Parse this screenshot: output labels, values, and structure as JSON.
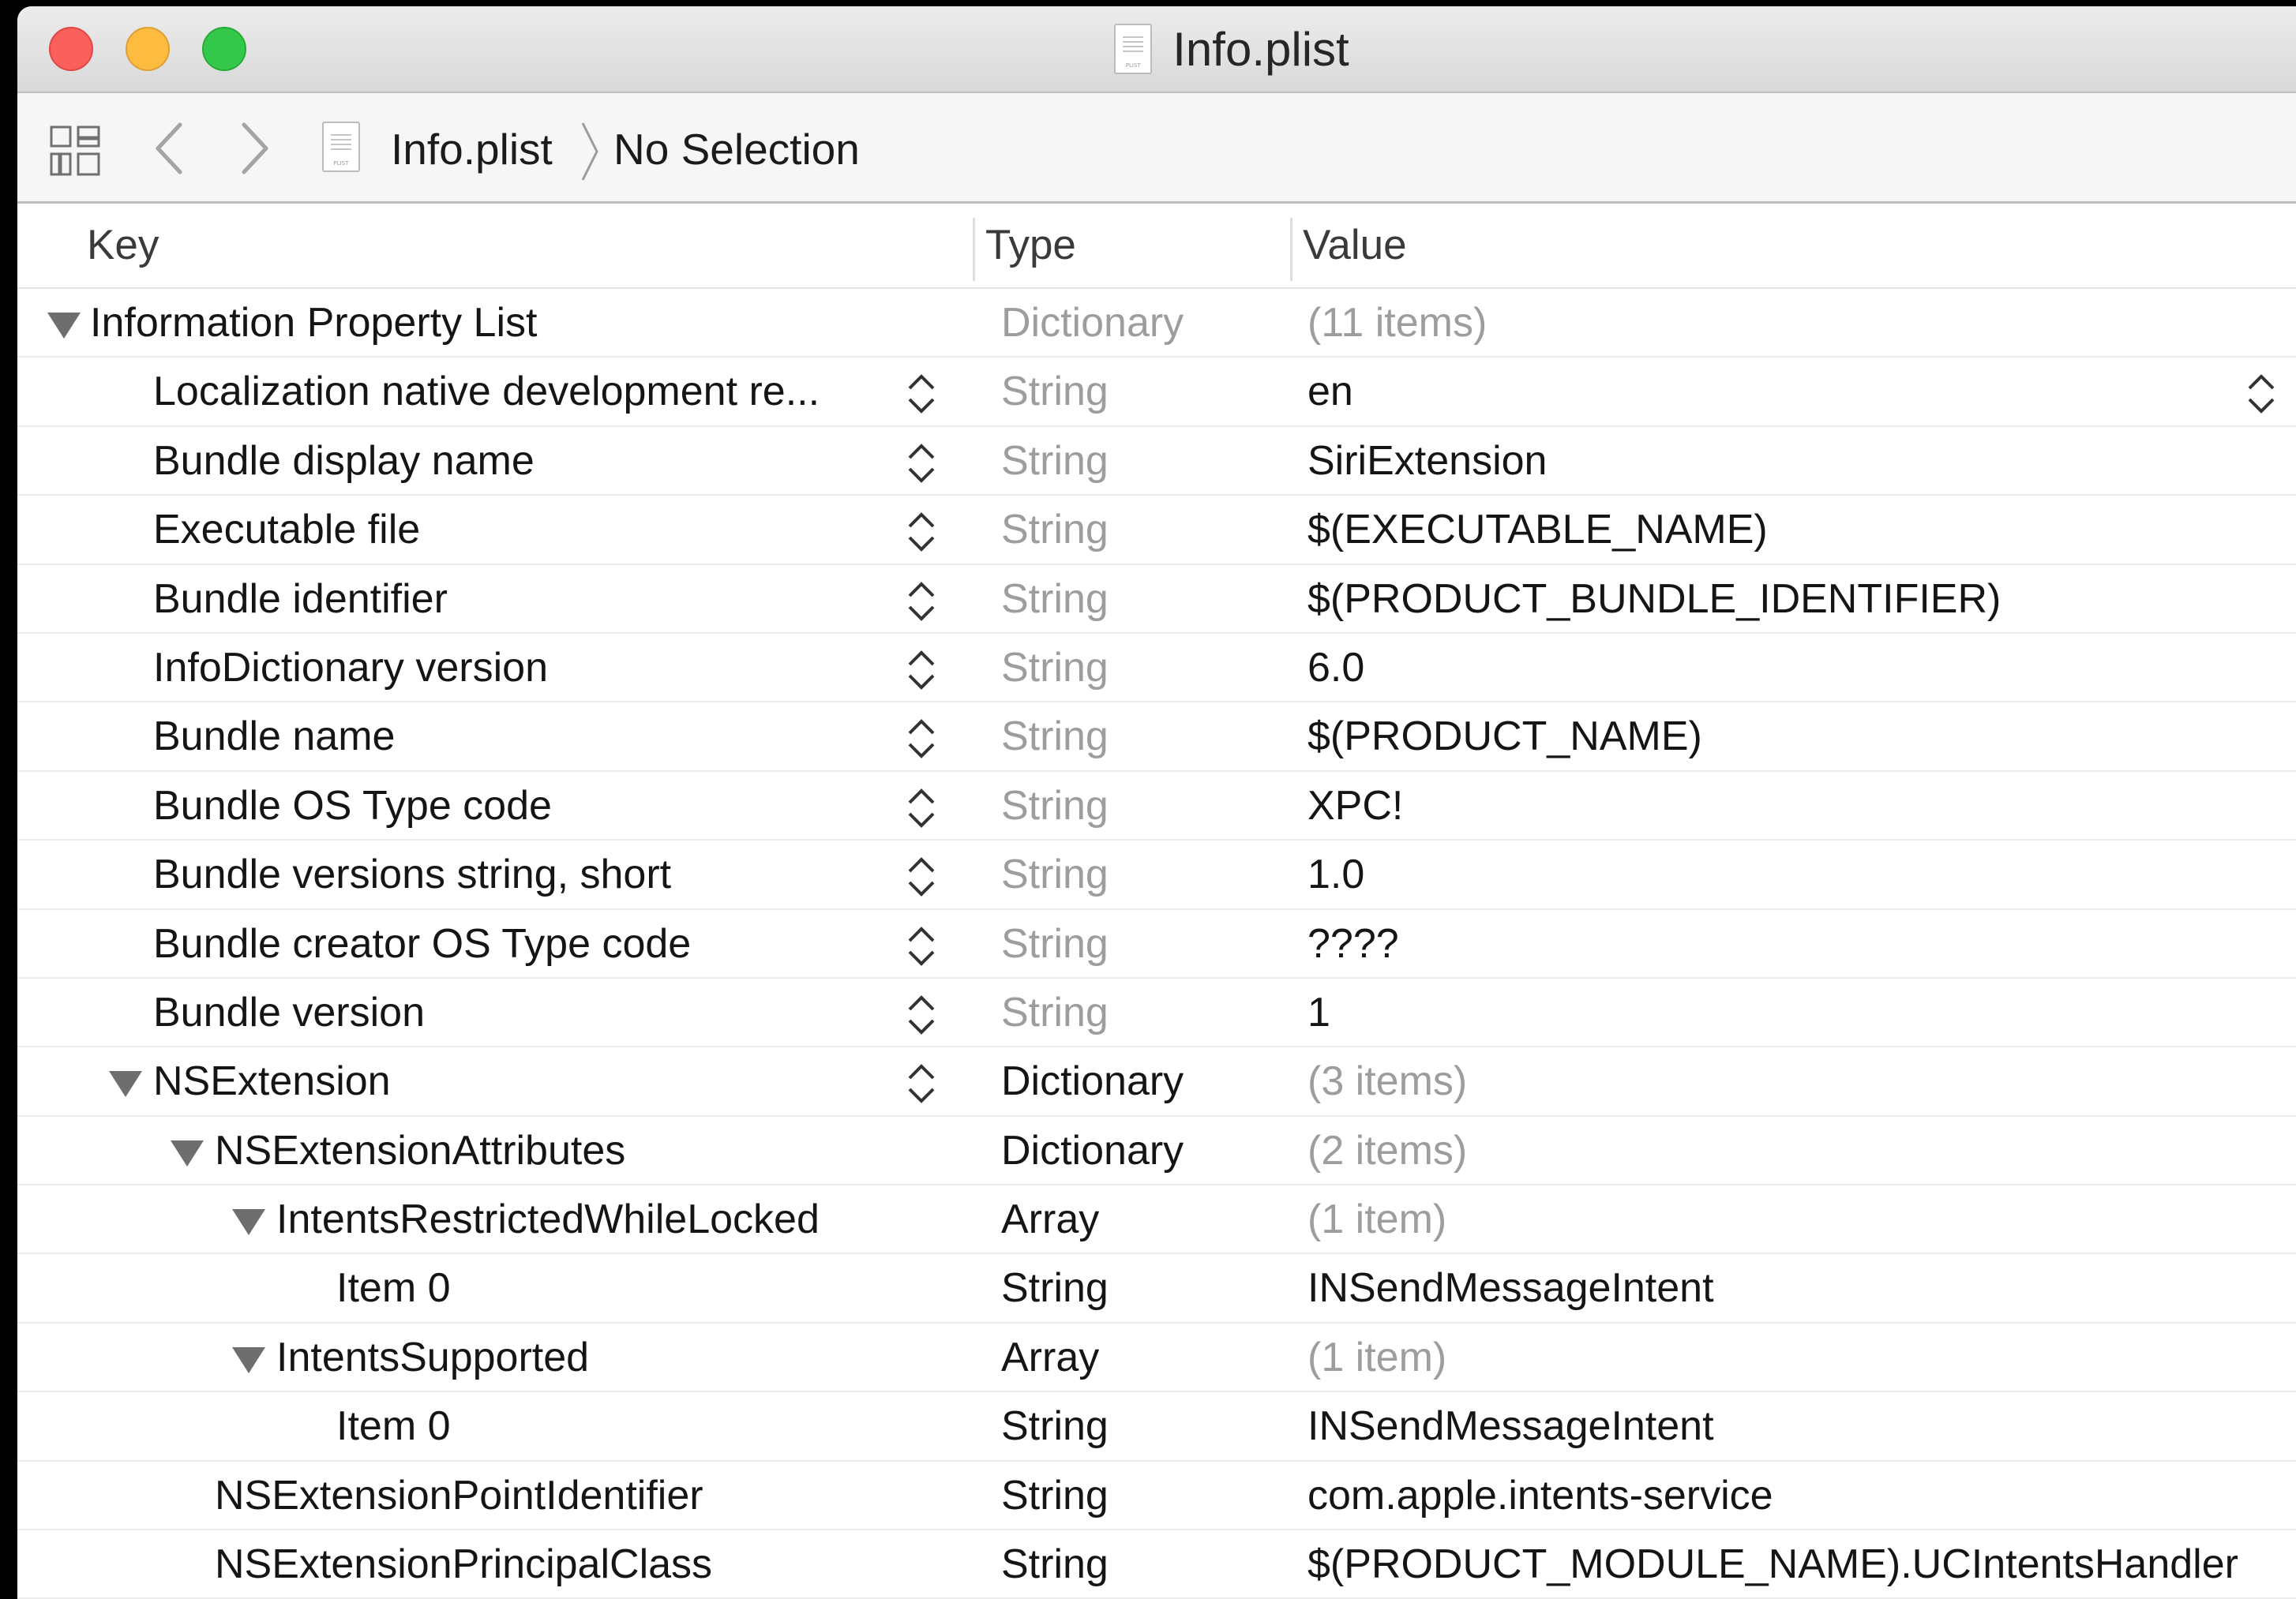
{
  "window": {
    "title": "Info.plist"
  },
  "icons": {
    "file": "plist-file-icon",
    "grid": "related-items-grid-icon",
    "back": "chevron-left-icon",
    "forward": "chevron-right-icon",
    "disclosure": "disclosure-triangle-icon",
    "stepper": "up-down-stepper-icon"
  },
  "jumpbar": {
    "file": "Info.plist",
    "selection": "No Selection"
  },
  "table": {
    "columns": {
      "key": "Key",
      "type": "Type",
      "value": "Value"
    },
    "rows": [
      {
        "key": "Information Property List",
        "type": "Dictionary",
        "value": "(11 items)"
      },
      {
        "key": "Localization native development re...",
        "type": "String",
        "value": "en"
      },
      {
        "key": "Bundle display name",
        "type": "String",
        "value": "SiriExtension"
      },
      {
        "key": "Executable file",
        "type": "String",
        "value": "$(EXECUTABLE_NAME)"
      },
      {
        "key": "Bundle identifier",
        "type": "String",
        "value": "$(PRODUCT_BUNDLE_IDENTIFIER)"
      },
      {
        "key": "InfoDictionary version",
        "type": "String",
        "value": "6.0"
      },
      {
        "key": "Bundle name",
        "type": "String",
        "value": "$(PRODUCT_NAME)"
      },
      {
        "key": "Bundle OS Type code",
        "type": "String",
        "value": "XPC!"
      },
      {
        "key": "Bundle versions string, short",
        "type": "String",
        "value": "1.0"
      },
      {
        "key": "Bundle creator OS Type code",
        "type": "String",
        "value": "????"
      },
      {
        "key": "Bundle version",
        "type": "String",
        "value": "1"
      },
      {
        "key": "NSExtension",
        "type": "Dictionary",
        "value": "(3 items)"
      },
      {
        "key": "NSExtensionAttributes",
        "type": "Dictionary",
        "value": "(2 items)"
      },
      {
        "key": "IntentsRestrictedWhileLocked",
        "type": "Array",
        "value": "(1 item)"
      },
      {
        "key": "Item 0",
        "type": "String",
        "value": "INSendMessageIntent"
      },
      {
        "key": "IntentsSupported",
        "type": "Array",
        "value": "(1 item)"
      },
      {
        "key": "Item 0",
        "type": "String",
        "value": "INSendMessageIntent"
      },
      {
        "key": "NSExtensionPointIdentifier",
        "type": "String",
        "value": "com.apple.intents-service"
      },
      {
        "key": "NSExtensionPrincipalClass",
        "type": "String",
        "value": "$(PRODUCT_MODULE_NAME).UCIntentsHandler"
      }
    ]
  }
}
